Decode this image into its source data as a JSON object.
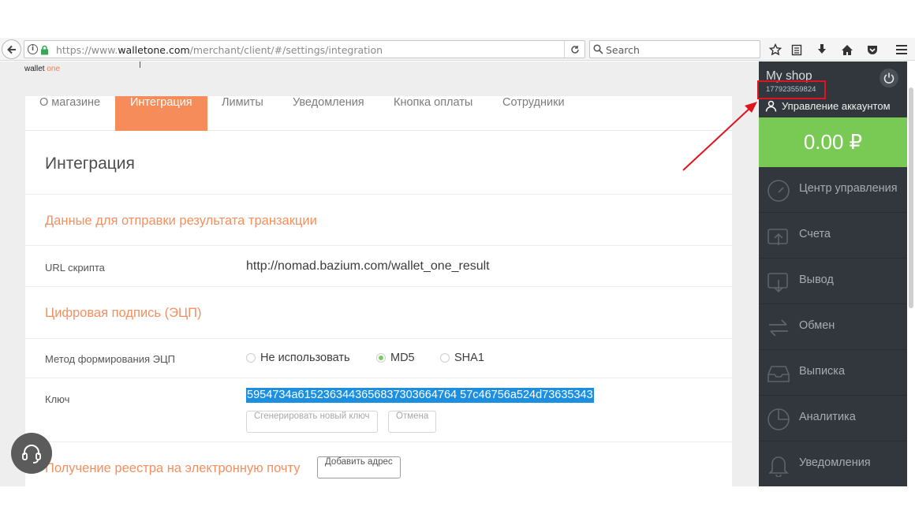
{
  "browser": {
    "url_prefix": "https://www.",
    "url_domain": "walletone.com",
    "url_path": "/merchant/client/#/settings/integration",
    "search_placeholder": "Search"
  },
  "logo": {
    "text": "wallet",
    "accent": "one"
  },
  "tabs": [
    {
      "label": "О магазине"
    },
    {
      "label": "Интеграция",
      "active": true
    },
    {
      "label": "Лимиты"
    },
    {
      "label": "Уведомления"
    },
    {
      "label": "Кнопка оплаты"
    },
    {
      "label": "Сотрудники"
    }
  ],
  "section_title": "Интеграция",
  "transaction": {
    "heading": "Данные для отправки результата транзакции",
    "url_label": "URL скрипта",
    "url_value": "http://nomad.bazium.com/wallet_one_result"
  },
  "signature": {
    "heading": "Цифровая подпись (ЭЦП)",
    "method_label": "Метод формирования ЭЦП",
    "options": [
      "Не использовать",
      "MD5",
      "SHA1"
    ],
    "selected": "MD5",
    "key_label": "Ключ",
    "key_value": "5954734a6152363443656837303664764 57c46756a524d73635343",
    "generate_button": "Сгенерировать новый ключ",
    "cancel_button": "Отмена"
  },
  "registry": {
    "heading": "Получение реестра на электронную почту",
    "add_button": "Добавить адрес"
  },
  "sidebar": {
    "shop_name": "My shop",
    "shop_id": "177923559824",
    "account_label": "Управление аккаунтом",
    "balance": "0.00 ₽",
    "menu": [
      {
        "label": "Центр управления",
        "icon": "speedometer-icon"
      },
      {
        "label": "Счета",
        "icon": "invoice-wallet-icon"
      },
      {
        "label": "Вывод",
        "icon": "withdraw-wallet-icon"
      },
      {
        "label": "Обмен",
        "icon": "exchange-arrows-icon"
      },
      {
        "label": "Выписка",
        "icon": "inbox-tray-icon"
      },
      {
        "label": "Аналитика",
        "icon": "pie-chart-icon"
      },
      {
        "label": "Уведомления",
        "icon": "bell-icon"
      }
    ]
  },
  "colors": {
    "accent_orange": "#f58c5a",
    "balance_green": "#79c955",
    "sidebar_bg": "#32373e",
    "selection_blue": "#1d8fe0",
    "annotation_red": "#e0141e"
  }
}
